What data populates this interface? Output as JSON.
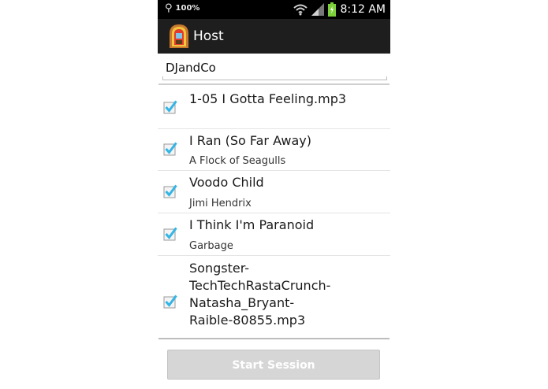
{
  "statusbar": {
    "battery_percent": "100%",
    "time": "8:12 AM"
  },
  "actionbar": {
    "title": "Host"
  },
  "host": {
    "session_name": "DJandCo"
  },
  "songs": [
    {
      "title": "1-05 I Gotta Feeling.mp3",
      "artist": "",
      "checked": true
    },
    {
      "title": "I Ran (So Far Away)",
      "artist": "A Flock of Seagulls",
      "checked": true
    },
    {
      "title": "Voodo Child",
      "artist": "Jimi Hendrix",
      "checked": true
    },
    {
      "title": "I Think I'm Paranoid",
      "artist": "Garbage",
      "checked": true
    },
    {
      "title_lines": [
        "Songster-",
        "TechTechRastaCrunch-",
        "Natasha_Bryant-",
        "Raible-80855.mp3"
      ],
      "artist": "",
      "checked": true
    }
  ],
  "actions": {
    "start_label": "Start Session"
  },
  "colors": {
    "checkmark": "#33b5e5",
    "action_bar": "#1e1e1e",
    "button_disabled": "#d6d6d6"
  }
}
